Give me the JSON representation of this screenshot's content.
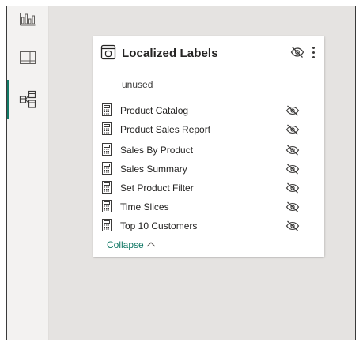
{
  "sidebar": {
    "items": [
      {
        "name": "report-view",
        "icon": "bar-chart-icon",
        "active": false
      },
      {
        "name": "data-view",
        "icon": "table-grid-icon",
        "active": false
      },
      {
        "name": "model-view",
        "icon": "model-diagram-icon",
        "active": true
      }
    ],
    "accent_color": "#117865"
  },
  "table_card": {
    "title": "Localized Labels",
    "header_icons": [
      "table-icon",
      "hidden-eye-icon",
      "more-options-icon"
    ],
    "section_label": "unused",
    "fields": [
      {
        "label": "Product Catalog",
        "icon": "calculator-icon",
        "hidden": true
      },
      {
        "label": "Product Sales Report",
        "icon": "calculator-icon",
        "hidden": true
      },
      {
        "label": "Sales By Product",
        "icon": "calculator-icon",
        "hidden": true
      },
      {
        "label": "Sales Summary",
        "icon": "calculator-icon",
        "hidden": true
      },
      {
        "label": "Set Product Filter",
        "icon": "calculator-icon",
        "hidden": true
      },
      {
        "label": "Time Slices",
        "icon": "calculator-icon",
        "hidden": true
      },
      {
        "label": "Top 10 Customers",
        "icon": "calculator-icon",
        "hidden": true
      }
    ],
    "collapse_label": "Collapse",
    "link_color": "#117865"
  }
}
